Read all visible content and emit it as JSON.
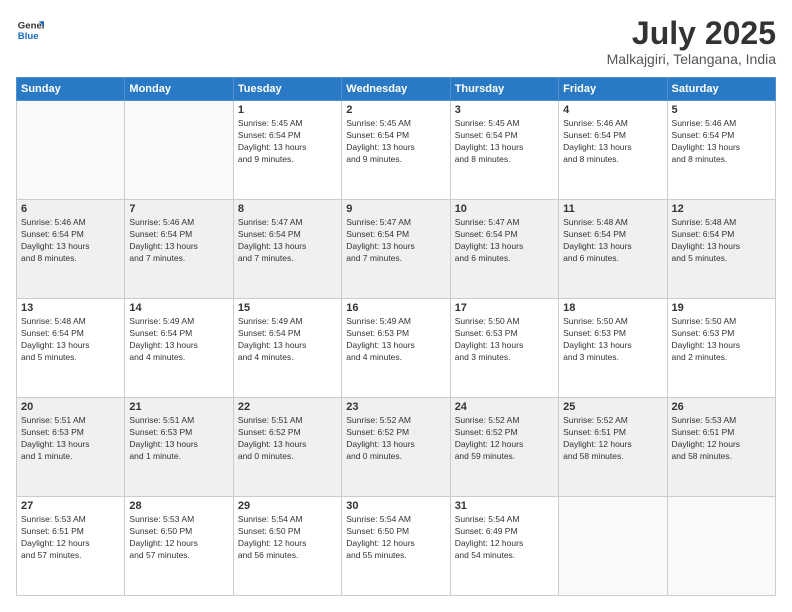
{
  "logo": {
    "line1": "General",
    "line2": "Blue"
  },
  "title": "July 2025",
  "location": "Malkajgiri, Telangana, India",
  "days_of_week": [
    "Sunday",
    "Monday",
    "Tuesday",
    "Wednesday",
    "Thursday",
    "Friday",
    "Saturday"
  ],
  "weeks": [
    [
      {
        "day": "",
        "info": ""
      },
      {
        "day": "",
        "info": ""
      },
      {
        "day": "1",
        "info": "Sunrise: 5:45 AM\nSunset: 6:54 PM\nDaylight: 13 hours\nand 9 minutes."
      },
      {
        "day": "2",
        "info": "Sunrise: 5:45 AM\nSunset: 6:54 PM\nDaylight: 13 hours\nand 9 minutes."
      },
      {
        "day": "3",
        "info": "Sunrise: 5:45 AM\nSunset: 6:54 PM\nDaylight: 13 hours\nand 8 minutes."
      },
      {
        "day": "4",
        "info": "Sunrise: 5:46 AM\nSunset: 6:54 PM\nDaylight: 13 hours\nand 8 minutes."
      },
      {
        "day": "5",
        "info": "Sunrise: 5:46 AM\nSunset: 6:54 PM\nDaylight: 13 hours\nand 8 minutes."
      }
    ],
    [
      {
        "day": "6",
        "info": "Sunrise: 5:46 AM\nSunset: 6:54 PM\nDaylight: 13 hours\nand 8 minutes."
      },
      {
        "day": "7",
        "info": "Sunrise: 5:46 AM\nSunset: 6:54 PM\nDaylight: 13 hours\nand 7 minutes."
      },
      {
        "day": "8",
        "info": "Sunrise: 5:47 AM\nSunset: 6:54 PM\nDaylight: 13 hours\nand 7 minutes."
      },
      {
        "day": "9",
        "info": "Sunrise: 5:47 AM\nSunset: 6:54 PM\nDaylight: 13 hours\nand 7 minutes."
      },
      {
        "day": "10",
        "info": "Sunrise: 5:47 AM\nSunset: 6:54 PM\nDaylight: 13 hours\nand 6 minutes."
      },
      {
        "day": "11",
        "info": "Sunrise: 5:48 AM\nSunset: 6:54 PM\nDaylight: 13 hours\nand 6 minutes."
      },
      {
        "day": "12",
        "info": "Sunrise: 5:48 AM\nSunset: 6:54 PM\nDaylight: 13 hours\nand 5 minutes."
      }
    ],
    [
      {
        "day": "13",
        "info": "Sunrise: 5:48 AM\nSunset: 6:54 PM\nDaylight: 13 hours\nand 5 minutes."
      },
      {
        "day": "14",
        "info": "Sunrise: 5:49 AM\nSunset: 6:54 PM\nDaylight: 13 hours\nand 4 minutes."
      },
      {
        "day": "15",
        "info": "Sunrise: 5:49 AM\nSunset: 6:54 PM\nDaylight: 13 hours\nand 4 minutes."
      },
      {
        "day": "16",
        "info": "Sunrise: 5:49 AM\nSunset: 6:53 PM\nDaylight: 13 hours\nand 4 minutes."
      },
      {
        "day": "17",
        "info": "Sunrise: 5:50 AM\nSunset: 6:53 PM\nDaylight: 13 hours\nand 3 minutes."
      },
      {
        "day": "18",
        "info": "Sunrise: 5:50 AM\nSunset: 6:53 PM\nDaylight: 13 hours\nand 3 minutes."
      },
      {
        "day": "19",
        "info": "Sunrise: 5:50 AM\nSunset: 6:53 PM\nDaylight: 13 hours\nand 2 minutes."
      }
    ],
    [
      {
        "day": "20",
        "info": "Sunrise: 5:51 AM\nSunset: 6:53 PM\nDaylight: 13 hours\nand 1 minute."
      },
      {
        "day": "21",
        "info": "Sunrise: 5:51 AM\nSunset: 6:53 PM\nDaylight: 13 hours\nand 1 minute."
      },
      {
        "day": "22",
        "info": "Sunrise: 5:51 AM\nSunset: 6:52 PM\nDaylight: 13 hours\nand 0 minutes."
      },
      {
        "day": "23",
        "info": "Sunrise: 5:52 AM\nSunset: 6:52 PM\nDaylight: 13 hours\nand 0 minutes."
      },
      {
        "day": "24",
        "info": "Sunrise: 5:52 AM\nSunset: 6:52 PM\nDaylight: 12 hours\nand 59 minutes."
      },
      {
        "day": "25",
        "info": "Sunrise: 5:52 AM\nSunset: 6:51 PM\nDaylight: 12 hours\nand 58 minutes."
      },
      {
        "day": "26",
        "info": "Sunrise: 5:53 AM\nSunset: 6:51 PM\nDaylight: 12 hours\nand 58 minutes."
      }
    ],
    [
      {
        "day": "27",
        "info": "Sunrise: 5:53 AM\nSunset: 6:51 PM\nDaylight: 12 hours\nand 57 minutes."
      },
      {
        "day": "28",
        "info": "Sunrise: 5:53 AM\nSunset: 6:50 PM\nDaylight: 12 hours\nand 57 minutes."
      },
      {
        "day": "29",
        "info": "Sunrise: 5:54 AM\nSunset: 6:50 PM\nDaylight: 12 hours\nand 56 minutes."
      },
      {
        "day": "30",
        "info": "Sunrise: 5:54 AM\nSunset: 6:50 PM\nDaylight: 12 hours\nand 55 minutes."
      },
      {
        "day": "31",
        "info": "Sunrise: 5:54 AM\nSunset: 6:49 PM\nDaylight: 12 hours\nand 54 minutes."
      },
      {
        "day": "",
        "info": ""
      },
      {
        "day": "",
        "info": ""
      }
    ]
  ]
}
